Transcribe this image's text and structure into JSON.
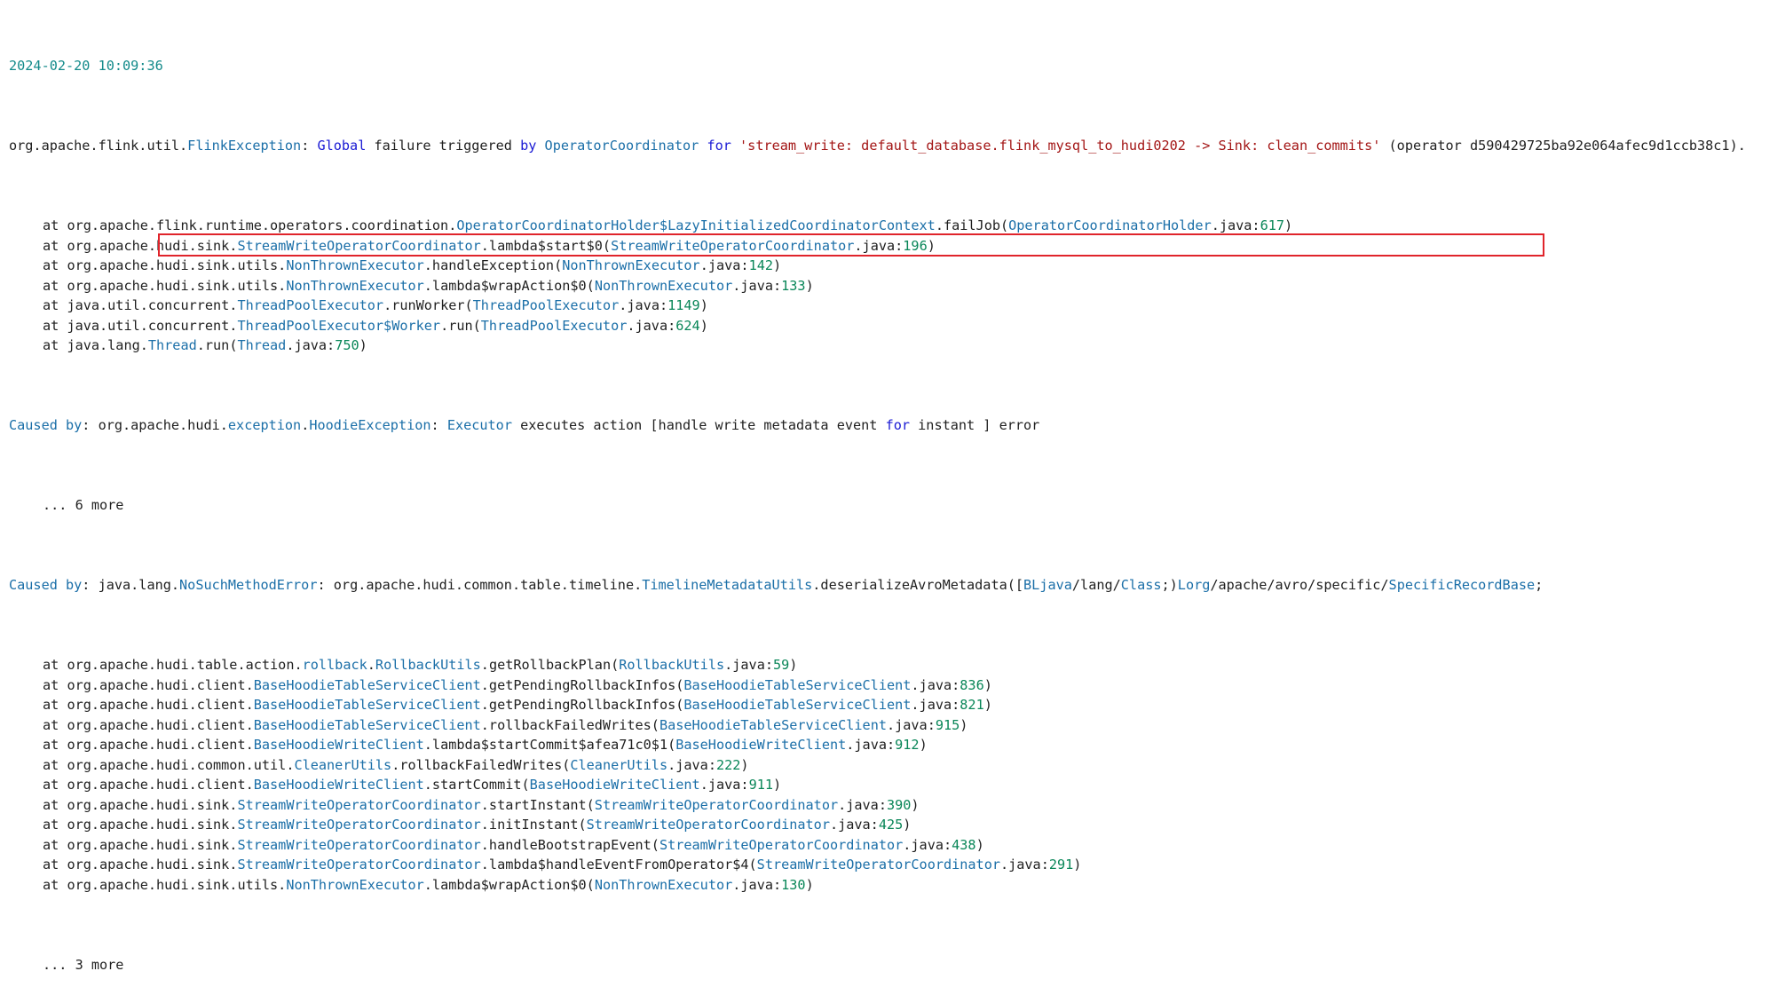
{
  "timestamp": "2024-02-20 10:09:36",
  "header": {
    "pkg": "org.apache.flink.util.",
    "exception": "FlinkException",
    "colon": ": ",
    "global": "Global",
    "failure": " failure triggered ",
    "by": "by",
    "sp1": " ",
    "coordinator": "OperatorCoordinator",
    "sp2": " ",
    "for": "for",
    "sp3": " ",
    "operator_string": "'stream_write: default_database.flink_mysql_to_hudi0202 -> Sink: clean_commits'",
    "operator_id": " (operator d590429725ba92e064afec9d1ccb38c1)."
  },
  "frames1": [
    {
      "at": "at ",
      "pre": "org.apache.flink.runtime.operators.coordination.",
      "cls": "OperatorCoordinatorHolder$LazyInitializedCoordinatorContext",
      "method": ".failJob(",
      "file": "OperatorCoordinatorHolder",
      "ext": ".java:",
      "line": "617",
      "close": ")"
    },
    {
      "at": "at ",
      "pre": "org.apache.hudi.sink.",
      "cls": "StreamWriteOperatorCoordinator",
      "method": ".lambda$start$0(",
      "file": "StreamWriteOperatorCoordinator",
      "ext": ".java:",
      "line": "196",
      "close": ")"
    },
    {
      "at": "at ",
      "pre": "org.apache.hudi.sink.utils.",
      "cls": "NonThrownExecutor",
      "method": ".handleException(",
      "file": "NonThrownExecutor",
      "ext": ".java:",
      "line": "142",
      "close": ")"
    },
    {
      "at": "at ",
      "pre": "org.apache.hudi.sink.utils.",
      "cls": "NonThrownExecutor",
      "method": ".lambda$wrapAction$0(",
      "file": "NonThrownExecutor",
      "ext": ".java:",
      "line": "133",
      "close": ")"
    },
    {
      "at": "at ",
      "pre": "java.util.concurrent.",
      "cls": "ThreadPoolExecutor",
      "method": ".runWorker(",
      "file": "ThreadPoolExecutor",
      "ext": ".java:",
      "line": "1149",
      "close": ")"
    },
    {
      "at": "at ",
      "pre": "java.util.concurrent.",
      "cls": "ThreadPoolExecutor$Worker",
      "method": ".run(",
      "file": "ThreadPoolExecutor",
      "ext": ".java:",
      "line": "624",
      "close": ")"
    },
    {
      "at": "at ",
      "pre": "java.lang.",
      "cls": "Thread",
      "method": ".run(",
      "file": "Thread",
      "ext": ".java:",
      "line": "750",
      "close": ")"
    }
  ],
  "cause1": {
    "label": "Caused by",
    "colon": ": ",
    "pre": "org.apache.hudi.",
    "pkg2": "exception",
    "dot": ".",
    "cls": "HoodieException",
    "colon2": ": ",
    "executor": "Executor",
    "msg1": " executes action [handle write metadata event ",
    "for": "for",
    "msg2": " instant ] error"
  },
  "more1": "... 6 more",
  "cause2": {
    "label": "Caused by",
    "colon": ": ",
    "pre": "java.lang.",
    "cls": "NoSuchMethodError",
    "colon2": ": ",
    "pkg": "org.apache.hudi.common.table.timeline.",
    "cls2": "TimelineMetadataUtils",
    "method": ".deserializeAvroMetadata([",
    "sig1": "BLjava",
    "sig2": "/lang/",
    "sig3": "Class",
    "sig4": ";)",
    "sig5": "Lorg",
    "sig6": "/apache/avro/specific/",
    "sig7": "SpecificRecordBase",
    "sig8": ";"
  },
  "frames2": [
    {
      "at": "at ",
      "pre": "org.apache.hudi.table.action.",
      "pkg2": "rollback",
      "dot": ".",
      "cls": "RollbackUtils",
      "method": ".getRollbackPlan(",
      "file": "RollbackUtils",
      "ext": ".java:",
      "line": "59",
      "close": ")"
    },
    {
      "at": "at ",
      "pre": "org.apache.hudi.client.",
      "cls": "BaseHoodieTableServiceClient",
      "method": ".getPendingRollbackInfos(",
      "file": "BaseHoodieTableServiceClient",
      "ext": ".java:",
      "line": "836",
      "close": ")"
    },
    {
      "at": "at ",
      "pre": "org.apache.hudi.client.",
      "cls": "BaseHoodieTableServiceClient",
      "method": ".getPendingRollbackInfos(",
      "file": "BaseHoodieTableServiceClient",
      "ext": ".java:",
      "line": "821",
      "close": ")"
    },
    {
      "at": "at ",
      "pre": "org.apache.hudi.client.",
      "cls": "BaseHoodieTableServiceClient",
      "method": ".rollbackFailedWrites(",
      "file": "BaseHoodieTableServiceClient",
      "ext": ".java:",
      "line": "915",
      "close": ")"
    },
    {
      "at": "at ",
      "pre": "org.apache.hudi.client.",
      "cls": "BaseHoodieWriteClient",
      "method": ".lambda$startCommit$afea71c0$1(",
      "file": "BaseHoodieWriteClient",
      "ext": ".java:",
      "line": "912",
      "close": ")"
    },
    {
      "at": "at ",
      "pre": "org.apache.hudi.common.util.",
      "cls": "CleanerUtils",
      "method": ".rollbackFailedWrites(",
      "file": "CleanerUtils",
      "ext": ".java:",
      "line": "222",
      "close": ")"
    },
    {
      "at": "at ",
      "pre": "org.apache.hudi.client.",
      "cls": "BaseHoodieWriteClient",
      "method": ".startCommit(",
      "file": "BaseHoodieWriteClient",
      "ext": ".java:",
      "line": "911",
      "close": ")"
    },
    {
      "at": "at ",
      "pre": "org.apache.hudi.sink.",
      "cls": "StreamWriteOperatorCoordinator",
      "method": ".startInstant(",
      "file": "StreamWriteOperatorCoordinator",
      "ext": ".java:",
      "line": "390",
      "close": ")"
    },
    {
      "at": "at ",
      "pre": "org.apache.hudi.sink.",
      "cls": "StreamWriteOperatorCoordinator",
      "method": ".initInstant(",
      "file": "StreamWriteOperatorCoordinator",
      "ext": ".java:",
      "line": "425",
      "close": ")"
    },
    {
      "at": "at ",
      "pre": "org.apache.hudi.sink.",
      "cls": "StreamWriteOperatorCoordinator",
      "method": ".handleBootstrapEvent(",
      "file": "StreamWriteOperatorCoordinator",
      "ext": ".java:",
      "line": "438",
      "close": ")"
    },
    {
      "at": "at ",
      "pre": "org.apache.hudi.sink.",
      "cls": "StreamWriteOperatorCoordinator",
      "method": ".lambda$handleEventFromOperator$4(",
      "file": "StreamWriteOperatorCoordinator",
      "ext": ".java:",
      "line": "291",
      "close": ")"
    },
    {
      "at": "at ",
      "pre": "org.apache.hudi.sink.utils.",
      "cls": "NonThrownExecutor",
      "method": ".lambda$wrapAction$0(",
      "file": "NonThrownExecutor",
      "ext": ".java:",
      "line": "130",
      "close": ")"
    }
  ],
  "more2": "... 3 more",
  "colors": {
    "timestamp": "#138a8a",
    "class": "#1b6fa8",
    "keyword": "#1a1ad4",
    "string": "#a31515",
    "number": "#098658",
    "highlight_border": "#e0242b"
  }
}
